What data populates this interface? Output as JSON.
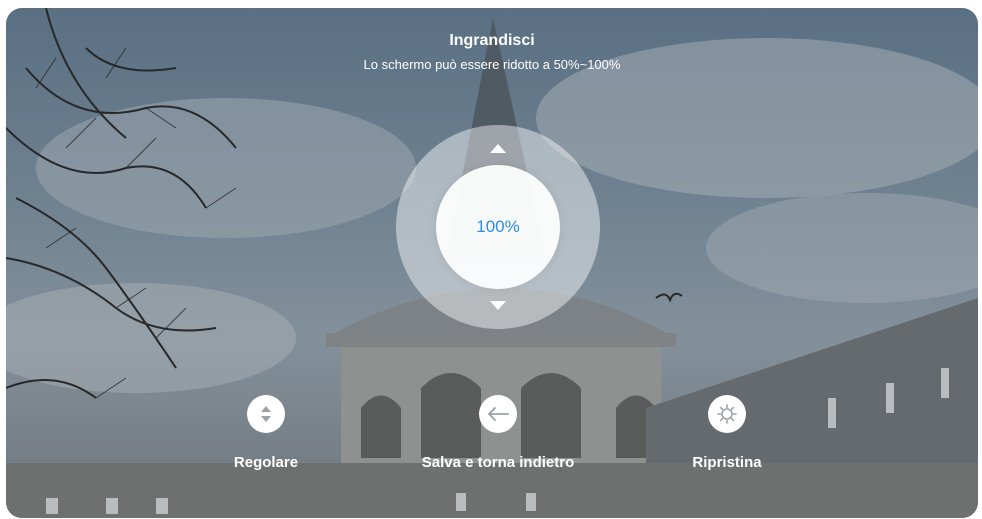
{
  "header": {
    "title": "Ingrandisci",
    "subtitle": "Lo schermo può essere ridotto a 50%~100%"
  },
  "zoom": {
    "value_label": "100%",
    "value_percent": 100,
    "min_percent": 50,
    "max_percent": 100,
    "accent_color": "#2d8ee8"
  },
  "actions": [
    {
      "label": "Regolare",
      "icon": "up-down-icon"
    },
    {
      "label": "Salva e torna indietro",
      "icon": "arrow-left-icon"
    },
    {
      "label": "Ripristina",
      "icon": "gear-icon"
    }
  ]
}
